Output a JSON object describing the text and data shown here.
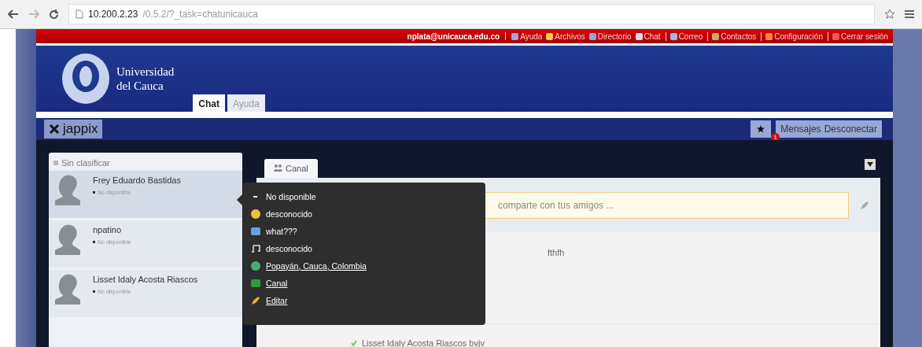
{
  "browser": {
    "url_host": "10.200.2.23",
    "url_path": "/0.5.2/?_task=chatunicauca"
  },
  "top_bar": {
    "user": "nplata@unicauca.edu.co",
    "links": [
      {
        "label": "Ayuda",
        "sep": false
      },
      {
        "label": "Archivos",
        "sep": false
      },
      {
        "label": "Directorio",
        "sep": false
      },
      {
        "label": "Chat",
        "sep": true
      },
      {
        "label": "Correo",
        "sep": true
      },
      {
        "label": "Contactos",
        "sep": true
      },
      {
        "label": "Configuración",
        "sep": true
      },
      {
        "label": "Cerrar sesión",
        "sep": false
      }
    ]
  },
  "logo": {
    "line1": "Universidad",
    "line2": "del Cauca"
  },
  "tabs": [
    {
      "label": "Chat",
      "selected": true
    },
    {
      "label": "Ayuda",
      "selected": false
    }
  ],
  "app_bar": {
    "brand": "jappix",
    "badge": "1",
    "buttons": [
      "Mensajes",
      "Desconectar"
    ]
  },
  "roster": {
    "group": "Sin clasificar",
    "contacts": [
      {
        "name": "Frey Eduardo Bastidas",
        "status": "No disponible",
        "selected": true
      },
      {
        "name": "npatino",
        "status": "No disponible",
        "selected": false
      },
      {
        "name": "Lisset Idaly Acosta Riascos",
        "status": "No disponible",
        "selected": false
      }
    ]
  },
  "popup": {
    "items": [
      {
        "kind": "status",
        "label": "No disponible"
      },
      {
        "kind": "mood",
        "label": "desconocido"
      },
      {
        "kind": "activity",
        "label": "what???"
      },
      {
        "kind": "music",
        "label": "desconocido"
      },
      {
        "kind": "geo",
        "label": "Popayán, Cauca, Colombia"
      },
      {
        "kind": "channel",
        "label": "Canal"
      },
      {
        "kind": "edit",
        "label": "Editar"
      }
    ]
  },
  "channel": {
    "tab": "Canal",
    "placeholder": "comparte con tus amigos ...",
    "posts": [
      {
        "text": "fthfh"
      },
      {
        "text": "Lisset Idaly Acosta Riascos bvjv"
      }
    ]
  }
}
